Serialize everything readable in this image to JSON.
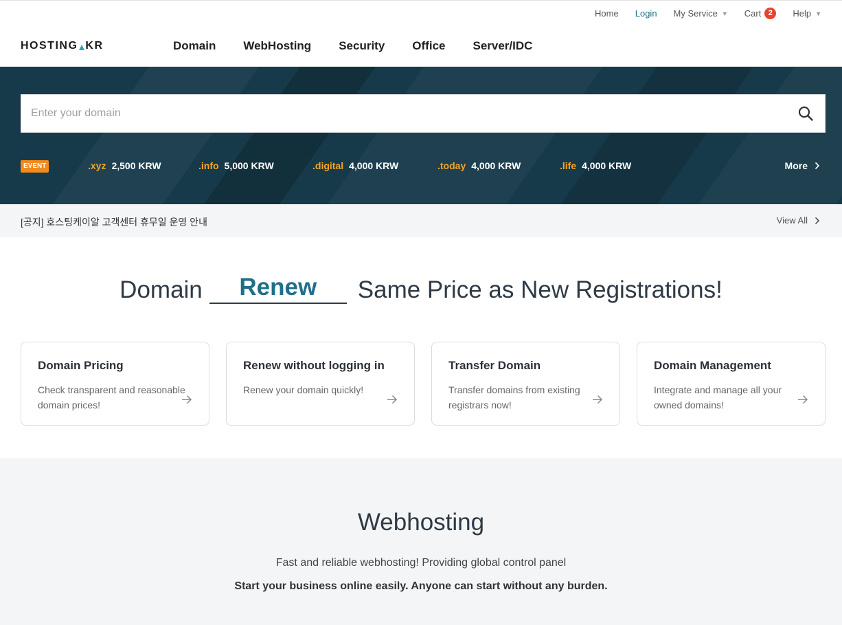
{
  "utility": {
    "home": "Home",
    "login": "Login",
    "my_service": "My Service",
    "cart": "Cart",
    "cart_count": "2",
    "help": "Help"
  },
  "header": {
    "logo": "HOSTING.KR",
    "nav": [
      "Domain",
      "WebHosting",
      "Security",
      "Office",
      "Server/IDC"
    ]
  },
  "search": {
    "placeholder": "Enter your domain"
  },
  "event": {
    "badge": "EVENT",
    "items": [
      {
        "ext": ".xyz",
        "price": "2,500 KRW"
      },
      {
        "ext": ".info",
        "price": "5,000 KRW"
      },
      {
        "ext": ".digital",
        "price": "4,000 KRW"
      },
      {
        "ext": ".today",
        "price": "4,000 KRW"
      },
      {
        "ext": ".life",
        "price": "4,000 KRW"
      }
    ],
    "more": "More"
  },
  "notice": {
    "text": "[공지] 호스팅케이알 고객센터 휴무일 운영 안내",
    "view_all": "View All"
  },
  "headline": {
    "prefix": "Domain",
    "keyword": "Renew",
    "suffix": "Same Price as New Registrations!"
  },
  "cards": [
    {
      "title": "Domain Pricing",
      "desc": "Check transparent and reasonable domain prices!"
    },
    {
      "title": "Renew without logging in",
      "desc": "Renew your domain quickly!"
    },
    {
      "title": "Transfer Domain",
      "desc": "Transfer domains from existing registrars now!"
    },
    {
      "title": "Domain Management",
      "desc": "Integrate and manage all your owned domains!"
    }
  ],
  "webhosting": {
    "title": "Webhosting",
    "line1": "Fast and reliable webhosting! Providing global control panel",
    "line2": "Start your business online easily. Anyone can start without any burden."
  },
  "colors": {
    "accent": "#1f6f8b",
    "event_orange": "#f28a1e",
    "tld_orange": "#f5a623",
    "hero_bg": "#173a4a",
    "cart_badge": "#e8432e"
  }
}
